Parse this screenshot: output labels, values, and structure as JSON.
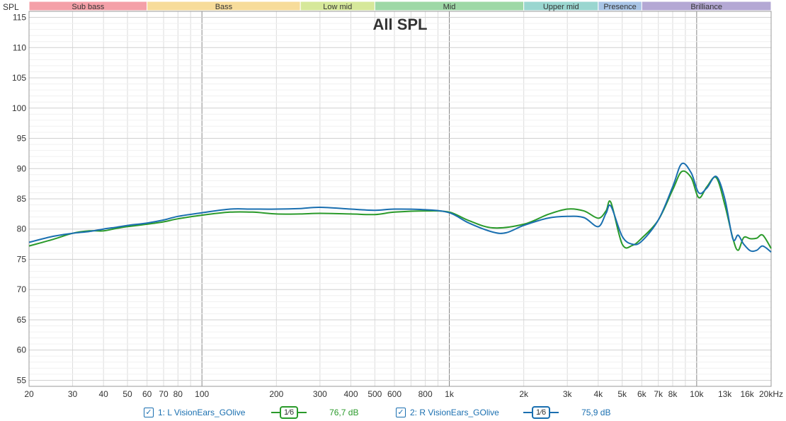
{
  "chart_data": {
    "type": "line",
    "title": "All SPL",
    "ylabel": "SPL",
    "xlabel": "",
    "x_scale": "log",
    "xlim": [
      20,
      20000
    ],
    "ylim": [
      54,
      116
    ],
    "grid": true,
    "x_ticks": [
      {
        "value": 20,
        "label": "20"
      },
      {
        "value": 30,
        "label": "30"
      },
      {
        "value": 40,
        "label": "40"
      },
      {
        "value": 50,
        "label": "50"
      },
      {
        "value": 60,
        "label": "60"
      },
      {
        "value": 70,
        "label": "70"
      },
      {
        "value": 80,
        "label": "80"
      },
      {
        "value": 100,
        "label": "100"
      },
      {
        "value": 200,
        "label": "200"
      },
      {
        "value": 300,
        "label": "300"
      },
      {
        "value": 400,
        "label": "400"
      },
      {
        "value": 500,
        "label": "500"
      },
      {
        "value": 600,
        "label": "600"
      },
      {
        "value": 800,
        "label": "800"
      },
      {
        "value": 1000,
        "label": "1k"
      },
      {
        "value": 2000,
        "label": "2k"
      },
      {
        "value": 3000,
        "label": "3k"
      },
      {
        "value": 4000,
        "label": "4k"
      },
      {
        "value": 5000,
        "label": "5k"
      },
      {
        "value": 6000,
        "label": "6k"
      },
      {
        "value": 7000,
        "label": "7k"
      },
      {
        "value": 8000,
        "label": "8k"
      },
      {
        "value": 10000,
        "label": "10k"
      },
      {
        "value": 13000,
        "label": "13k"
      },
      {
        "value": 16000,
        "label": "16k"
      },
      {
        "value": 20000,
        "label": "20kHz"
      }
    ],
    "y_ticks": [
      55,
      60,
      65,
      70,
      75,
      80,
      85,
      90,
      95,
      100,
      105,
      110,
      115
    ],
    "bands": [
      {
        "name": "Sub bass",
        "from": 20,
        "to": 60,
        "color": "#f4a0a8"
      },
      {
        "name": "Bass",
        "from": 60,
        "to": 250,
        "color": "#f7dc9a"
      },
      {
        "name": "Low mid",
        "from": 250,
        "to": 500,
        "color": "#d6e89a"
      },
      {
        "name": "Mid",
        "from": 500,
        "to": 2000,
        "color": "#9ed8a6"
      },
      {
        "name": "Upper mid",
        "from": 2000,
        "to": 4000,
        "color": "#9ad6d0"
      },
      {
        "name": "Presence",
        "from": 4000,
        "to": 6000,
        "color": "#a8c4e6"
      },
      {
        "name": "Brilliance",
        "from": 6000,
        "to": 20000,
        "color": "#b4a8d4"
      }
    ],
    "series": [
      {
        "name": "L VisionEars_GOlive",
        "color": "#2a9a2a",
        "x": [
          20,
          25,
          30,
          35,
          40,
          45,
          50,
          60,
          70,
          80,
          100,
          130,
          160,
          200,
          250,
          300,
          400,
          500,
          600,
          800,
          1000,
          1200,
          1500,
          2000,
          2500,
          3000,
          3500,
          4000,
          4300,
          4500,
          5000,
          5500,
          6000,
          7000,
          8000,
          8700,
          9500,
          10200,
          11000,
          12000,
          13000,
          14000,
          14700,
          15500,
          16500,
          17500,
          18500,
          20000
        ],
        "y": [
          77.2,
          78.3,
          79.3,
          79.7,
          79.7,
          80.1,
          80.4,
          80.8,
          81.2,
          81.7,
          82.3,
          82.8,
          82.8,
          82.5,
          82.5,
          82.6,
          82.5,
          82.4,
          82.8,
          83.0,
          82.8,
          81.4,
          80.2,
          80.8,
          82.4,
          83.3,
          83.0,
          81.8,
          83.0,
          84.4,
          77.5,
          77.3,
          78.5,
          81.5,
          86.5,
          89.5,
          88.5,
          85.2,
          87.0,
          88.5,
          84.0,
          78.5,
          76.5,
          78.6,
          78.4,
          78.5,
          79.0,
          76.8
        ]
      },
      {
        "name": "R VisionEars_GOlive",
        "color": "#1a6fb0",
        "x": [
          20,
          25,
          30,
          35,
          40,
          45,
          50,
          60,
          70,
          80,
          100,
          130,
          160,
          200,
          250,
          300,
          400,
          500,
          600,
          800,
          1000,
          1200,
          1500,
          1700,
          2000,
          2500,
          3000,
          3500,
          4000,
          4300,
          4500,
          5000,
          5500,
          6000,
          7000,
          8000,
          8700,
          9500,
          10200,
          11000,
          12000,
          13000,
          14000,
          14700,
          15500,
          16500,
          17500,
          18500,
          20000
        ],
        "y": [
          77.8,
          78.8,
          79.3,
          79.6,
          80.0,
          80.3,
          80.6,
          81.0,
          81.5,
          82.1,
          82.7,
          83.3,
          83.3,
          83.3,
          83.4,
          83.6,
          83.3,
          83.1,
          83.3,
          83.2,
          82.7,
          81.0,
          79.5,
          79.4,
          80.6,
          81.8,
          82.1,
          81.9,
          80.4,
          82.6,
          83.8,
          78.8,
          77.5,
          78.0,
          81.5,
          87.0,
          90.8,
          89.3,
          86.0,
          86.8,
          88.7,
          85.0,
          78.4,
          79.0,
          77.5,
          76.4,
          76.5,
          77.2,
          76.2
        ]
      }
    ],
    "legend": [
      {
        "index_label": "1: L VisionEars_GOlive",
        "smoothing": "1⁄6",
        "value": "76,7 dB",
        "checked": "✓",
        "color": "#2a9a2a"
      },
      {
        "index_label": "2: R VisionEars_GOlive",
        "smoothing": "1⁄6",
        "value": "75,9 dB",
        "checked": "✓",
        "color": "#1a6fb0"
      }
    ]
  }
}
